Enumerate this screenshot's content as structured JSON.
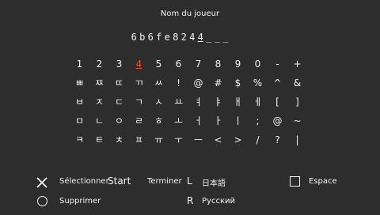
{
  "title": "Nom du joueur",
  "name_chars": [
    "6",
    "b",
    "6",
    "f",
    "e",
    "8",
    "2",
    "4",
    "4",
    "_",
    "_",
    "_"
  ],
  "cursor_index": 8,
  "keyboard": [
    [
      "1",
      "2",
      "3",
      "4",
      "5",
      "6",
      "7",
      "8",
      "9",
      "0",
      "-",
      "+"
    ],
    [
      "ㅃ",
      "ㅉ",
      "ㄸ",
      "ㄲ",
      "ㅆ",
      "!",
      "@",
      "#",
      "$",
      "%",
      "^",
      "&"
    ],
    [
      "ㅂ",
      "ㅈ",
      "ㄷ",
      "ㄱ",
      "ㅅ",
      "ㅛ",
      "ㅕ",
      "ㅑ",
      "ㅐ",
      "ㅔ",
      "[",
      "]"
    ],
    [
      "ㅁ",
      "ㄴ",
      "ㅇ",
      "ㄹ",
      "ㅎ",
      "ㅗ",
      "ㅓ",
      "ㅏ",
      "ㅣ",
      ";",
      "@",
      "~"
    ],
    [
      "ㅋ",
      "ㅌ",
      "ㅊ",
      "ㅍ",
      "ㅠ",
      "ㅜ",
      "ㅡ",
      "<",
      ">",
      "/",
      "?",
      "|"
    ]
  ],
  "selected_key": "4",
  "legend": {
    "select_label": "Sélectionner",
    "start_label": "Start",
    "finish_label": "Terminer",
    "l_label": "L",
    "japanese_label": "日本語",
    "space_label": "Espace",
    "delete_label": "Supprimer",
    "r_label": "R",
    "russian_label": "Русский"
  }
}
